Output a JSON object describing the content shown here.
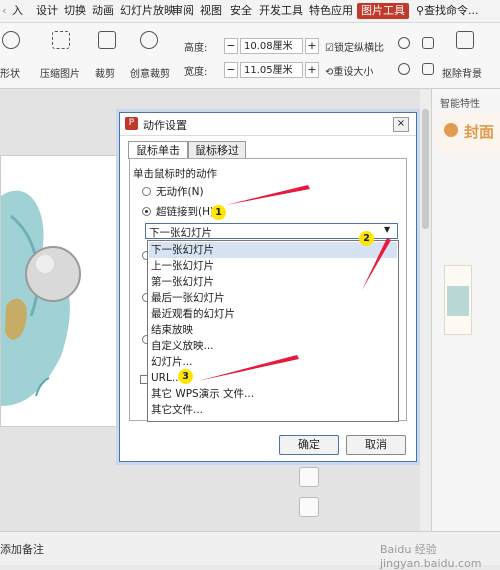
{
  "ribbon_tabs": [
    "入",
    "设计",
    "切换",
    "动画",
    "幻灯片放映",
    "审阅",
    "视图",
    "安全",
    "开发工具",
    "特色应用",
    "图片工具",
    "查找命令..."
  ],
  "ribbon": {
    "shape_label": "形状",
    "compress_label": "压缩图片",
    "crop_label": "裁剪",
    "creative_crop_label": "创意裁剪",
    "height_label": "高度:",
    "height_value": "10.08厘米",
    "width_label": "宽度:",
    "width_value": "11.05厘米",
    "lock_ratio_label": "锁定纵横比",
    "reset_size_label": "重设大小",
    "remove_bg_label": "抠除背景",
    "minus": "−",
    "plus": "+"
  },
  "right_panel": {
    "title": "智能特性",
    "cover_label": "封面"
  },
  "status_bar": {
    "notes_label": "添加备注"
  },
  "watermark": "Baidu 经验 jingyan.baidu.com",
  "dialog": {
    "title": "动作设置",
    "close": "×",
    "tabs": [
      "鼠标单击",
      "鼠标移过"
    ],
    "group_label": "单击鼠标时的动作",
    "radio_none": "无动作(N)",
    "radio_hyperlink": "超链接到(H):",
    "select_value": "下一张幻灯片",
    "options": [
      "下一张幻灯片",
      "上一张幻灯片",
      "第一张幻灯片",
      "最后一张幻灯片",
      "最近观看的幻灯片",
      "结束放映",
      "自定义放映...",
      "幻灯片...",
      "URL...",
      "其它 WPS演示 文件...",
      "其它文件..."
    ],
    "ok_label": "确定",
    "cancel_label": "取消"
  },
  "badges": [
    "1",
    "2",
    "3"
  ],
  "colors": {
    "accent": "#c0392b",
    "arrow": "#e8193c",
    "badge": "#ffe500"
  }
}
